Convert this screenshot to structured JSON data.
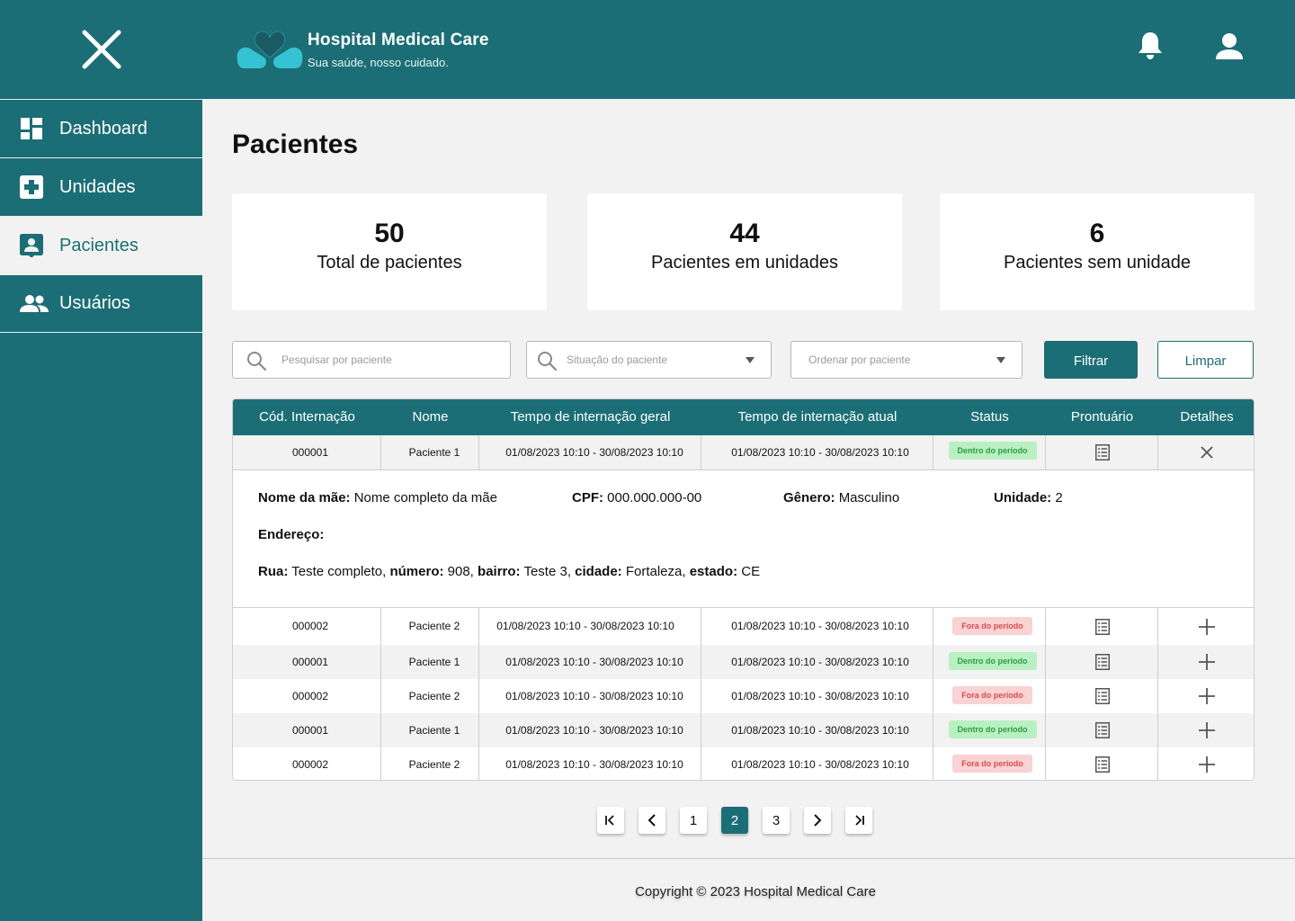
{
  "header": {
    "brand_title": "Hospital Medical Care",
    "brand_subtitle": "Sua saúde, nosso cuidado.",
    "logo": "hands-heart-logo",
    "accent_color": "#1c6e76"
  },
  "sidebar": {
    "items": [
      {
        "label": "Dashboard",
        "icon": "dashboard-icon",
        "active": false
      },
      {
        "label": "Unidades",
        "icon": "medical-plus-icon",
        "active": false
      },
      {
        "label": "Pacientes",
        "icon": "patient-badge-icon",
        "active": true
      },
      {
        "label": "Usuários",
        "icon": "users-icon",
        "active": false
      }
    ]
  },
  "main": {
    "title": "Pacientes",
    "stats": [
      {
        "value": "50",
        "label": "Total de pacientes"
      },
      {
        "value": "44",
        "label": "Pacientes em unidades"
      },
      {
        "value": "6",
        "label": "Pacientes sem unidade"
      }
    ],
    "filters": {
      "search_placeholder": "Pesquisar por paciente",
      "status_placeholder": "Situação do paciente",
      "order_placeholder": "Ordenar por paciente",
      "filter_label": "Filtrar",
      "clear_label": "Limpar"
    },
    "table": {
      "headers": [
        "Cód. Internação",
        "Nome",
        "Tempo de internação geral",
        "Tempo de internação atual",
        "Status",
        "Prontuário",
        "Detalhes"
      ],
      "expanded_row": {
        "code": "000001",
        "name": "Paciente 1",
        "general": "01/08/2023 10:10 - 30/08/2023 10:10",
        "current": "01/08/2023 10:10 - 30/08/2023 10:10",
        "status": "Dentro do período"
      },
      "details": {
        "mother_label": "Nome da mãe:",
        "mother_value": "Nome completo da mãe",
        "cpf_label": "CPF:",
        "cpf_value": "000.000.000-00",
        "gender_label": "Gênero:",
        "gender_value": "Masculino",
        "unit_label": "Unidade:",
        "unit_value": "2",
        "address_label": "Endereço:",
        "street_label": "Rua:",
        "street_value": "Teste completo,",
        "number_label": "número:",
        "number_value": "908,",
        "district_label": "bairro:",
        "district_value": "Teste 3,",
        "city_label": "cidade:",
        "city_value": "Fortaleza,",
        "state_label": "estado:",
        "state_value": "CE"
      },
      "rows": [
        {
          "code": "000002",
          "name": "Paciente 2",
          "general": "01/08/2023 10:10 - 30/08/2023 10:10",
          "current": "01/08/2023 10:10 - 30/08/2023 10:10",
          "status": "Fora do período"
        },
        {
          "code": "000001",
          "name": "Paciente 1",
          "general": "01/08/2023 10:10 - 30/08/2023 10:10",
          "current": "01/08/2023 10:10 - 30/08/2023 10:10",
          "status": "Dentro do período"
        },
        {
          "code": "000002",
          "name": "Paciente 2",
          "general": "01/08/2023 10:10 - 30/08/2023 10:10",
          "current": "01/08/2023 10:10 - 30/08/2023 10:10",
          "status": "Fora do período"
        },
        {
          "code": "000001",
          "name": "Paciente 1",
          "general": "01/08/2023 10:10 - 30/08/2023 10:10",
          "current": "01/08/2023 10:10 - 30/08/2023 10:10",
          "status": "Dentro do período"
        },
        {
          "code": "000002",
          "name": "Paciente 2",
          "general": "01/08/2023 10:10 - 30/08/2023 10:10",
          "current": "01/08/2023 10:10 - 30/08/2023 10:10",
          "status": "Fora do período"
        }
      ],
      "status_colors": {
        "ok_bg": "#b8f0c2",
        "ok_fg": "#2e9b46",
        "bad_bg": "#f9d2d3",
        "bad_fg": "#d94a4f"
      }
    },
    "pagination": {
      "pages": [
        "1",
        "2",
        "3"
      ],
      "current": "2",
      "first_icon": "first-page-icon",
      "prev_icon": "chevron-left-icon",
      "next_icon": "chevron-right-icon",
      "last_icon": "last-page-icon"
    }
  },
  "footer": {
    "copyright": "Copyright © 2023 Hospital Medical Care"
  }
}
